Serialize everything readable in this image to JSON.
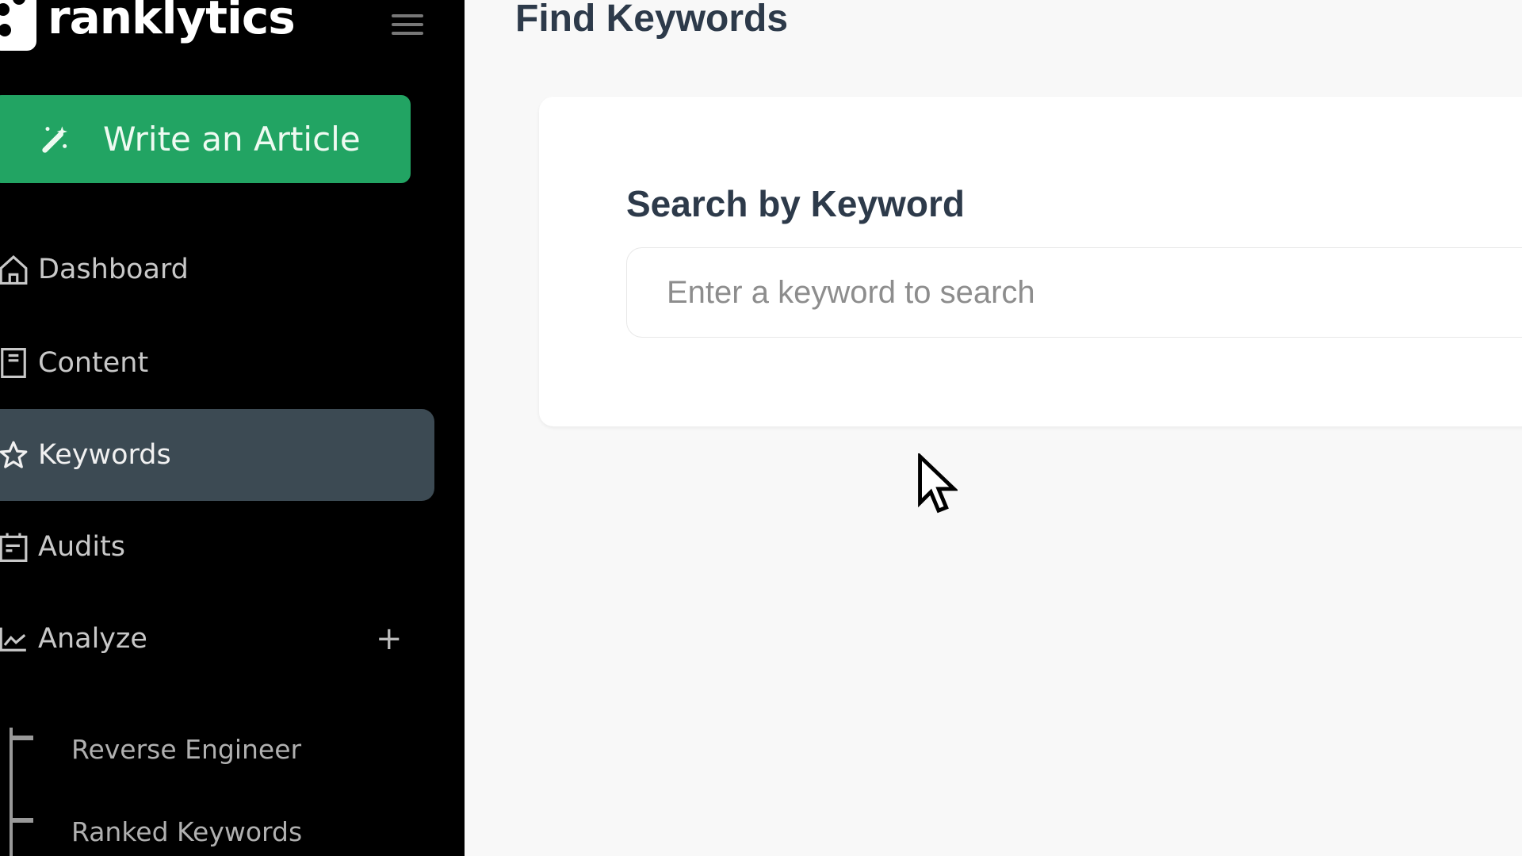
{
  "brand": {
    "name": "ranklytics",
    "accent": "#22a463"
  },
  "sidebar": {
    "menu_icon": "hamburger-icon",
    "cta": {
      "label": "Write an Article",
      "icon": "magic-wand-icon"
    },
    "items": [
      {
        "label": "Dashboard",
        "icon": "home-icon",
        "active": false
      },
      {
        "label": "Content",
        "icon": "document-icon",
        "active": false
      },
      {
        "label": "Keywords",
        "icon": "star-icon",
        "active": true
      },
      {
        "label": "Audits",
        "icon": "calendar-icon",
        "active": false
      },
      {
        "label": "Analyze",
        "icon": "chart-line-icon",
        "active": false,
        "expand_symbol": "+"
      }
    ],
    "sub_items": [
      {
        "label": "Reverse Engineer"
      },
      {
        "label": "Ranked Keywords"
      }
    ]
  },
  "main": {
    "title": "Find Keywords",
    "search_card": {
      "title": "Search by Keyword",
      "input_value": "",
      "input_placeholder": "Enter a keyword to search"
    }
  }
}
